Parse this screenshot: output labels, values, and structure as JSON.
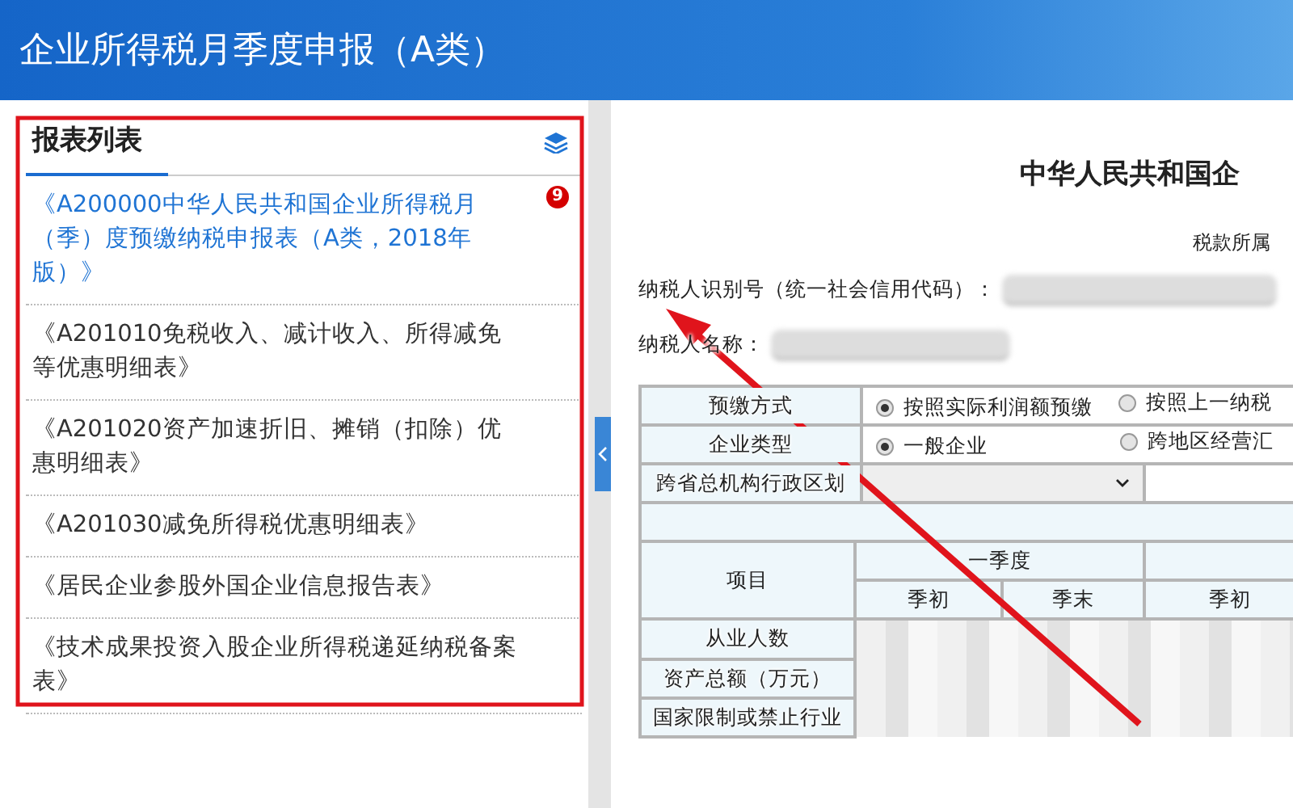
{
  "window": {
    "title": "企业所得税月季度申报（A类）"
  },
  "sidebar": {
    "title": "报表列表",
    "items": [
      {
        "label": "《A200000中华人民共和国企业所得税月（季）度预缴纳税申报表（A类，2018年版）》",
        "selected": true,
        "badge": "9"
      },
      {
        "label": "《A201010免税收入、减计收入、所得减免等优惠明细表》",
        "selected": false
      },
      {
        "label": "《A201020资产加速折旧、摊销（扣除）优惠明细表》",
        "selected": false
      },
      {
        "label": "《A201030减免所得税优惠明细表》",
        "selected": false
      },
      {
        "label": "《居民企业参股外国企业信息报告表》",
        "selected": false
      },
      {
        "label": "《技术成果投资入股企业所得税递延纳税备案表》",
        "selected": false
      }
    ]
  },
  "form": {
    "title": "中华人民共和国企",
    "period_label": "税款所属",
    "fields": [
      {
        "label": "纳税人识别号（统一社会信用代码）："
      },
      {
        "label": "纳税人名称："
      }
    ],
    "rows": [
      {
        "kind": "radio",
        "label": "预缴方式",
        "options": [
          {
            "label": "按照实际利润额预缴",
            "selected": true
          },
          {
            "label": "按照上一纳税",
            "selected": false
          }
        ]
      },
      {
        "kind": "radio",
        "label": "企业类型",
        "options": [
          {
            "label": "一般企业",
            "selected": true
          },
          {
            "label": "跨地区经营汇",
            "selected": false
          }
        ]
      },
      {
        "kind": "select",
        "label": "跨省总机构行政区划"
      }
    ],
    "table": {
      "header": "项目",
      "group": "一季度",
      "subcolumns": [
        "季初",
        "季末",
        "季初"
      ],
      "rows": [
        "从业人数",
        "资产总额（万元）",
        "国家限制或禁止行业"
      ]
    }
  }
}
